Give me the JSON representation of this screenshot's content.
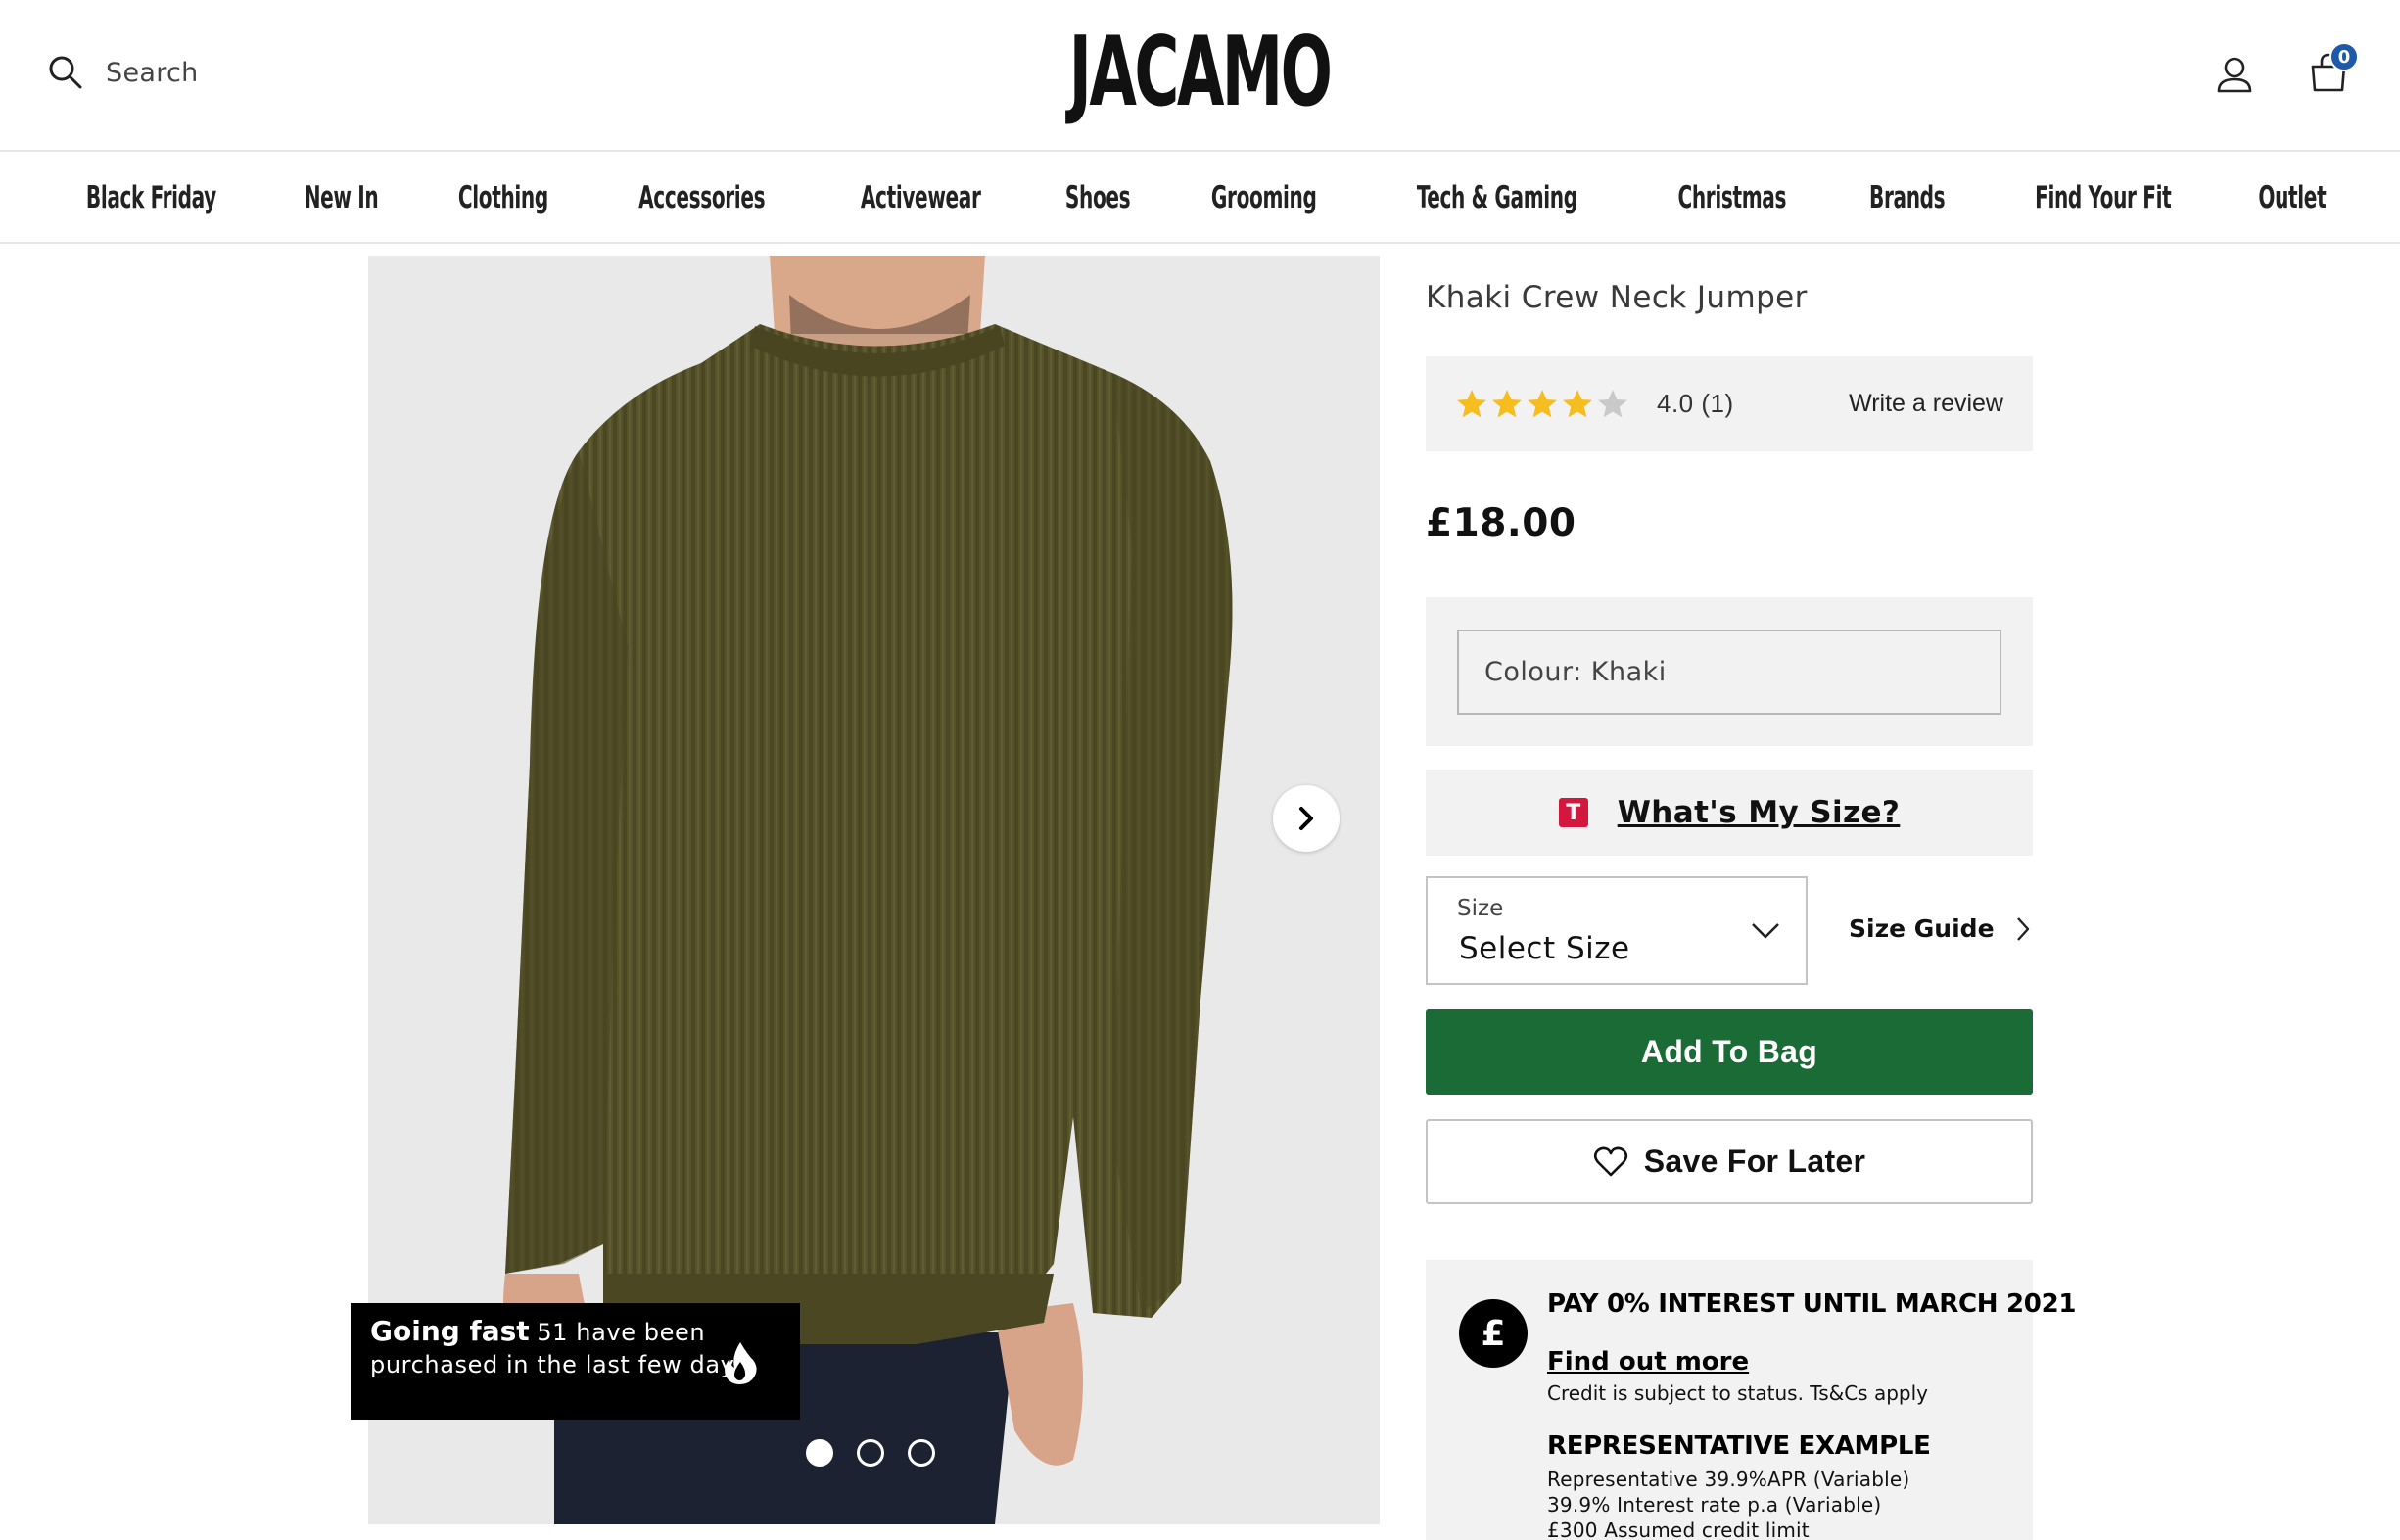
{
  "header": {
    "search_placeholder": "Search",
    "logo": "JACAMO",
    "bag_count": "0"
  },
  "nav": {
    "items": [
      "Black Friday",
      "New In",
      "Clothing",
      "Accessories",
      "Activewear",
      "Shoes",
      "Grooming",
      "Tech & Gaming",
      "Christmas",
      "Brands",
      "Find Your Fit",
      "Outlet"
    ]
  },
  "gallery": {
    "badge_title": "Going fast",
    "badge_text": "51 have been purchased in the last few days",
    "active_dot": 1,
    "dot_count": 3
  },
  "product": {
    "title": "Khaki Crew Neck Jumper",
    "rating": 4.0,
    "rating_text": "4.0",
    "review_count": "(1)",
    "write_review": "Write a review",
    "price": "£18.00",
    "colour_field": "Colour: Khaki",
    "whats_my_size": "What's My Size?",
    "size_label": "Size",
    "size_value": "Select Size",
    "size_guide": "Size Guide",
    "add_to_bag": "Add To Bag",
    "save_for_later": "Save For Later"
  },
  "credit": {
    "symbol": "£",
    "heading": "PAY 0% INTEREST UNTIL MARCH 2021",
    "find_out_more": "Find out more",
    "note": "Credit is subject to status. Ts&Cs apply",
    "rep_heading": "REPRESENTATIVE EXAMPLE",
    "rep_lines": [
      "Representative 39.9%APR (Variable)",
      "39.9% Interest rate p.a (Variable)",
      "£300 Assumed credit limit"
    ]
  },
  "colors": {
    "add_to_bag": "#1b6b37",
    "bag_badge": "#1e5aa8",
    "star": "#f5bd1f",
    "jumper": "#56522a"
  }
}
